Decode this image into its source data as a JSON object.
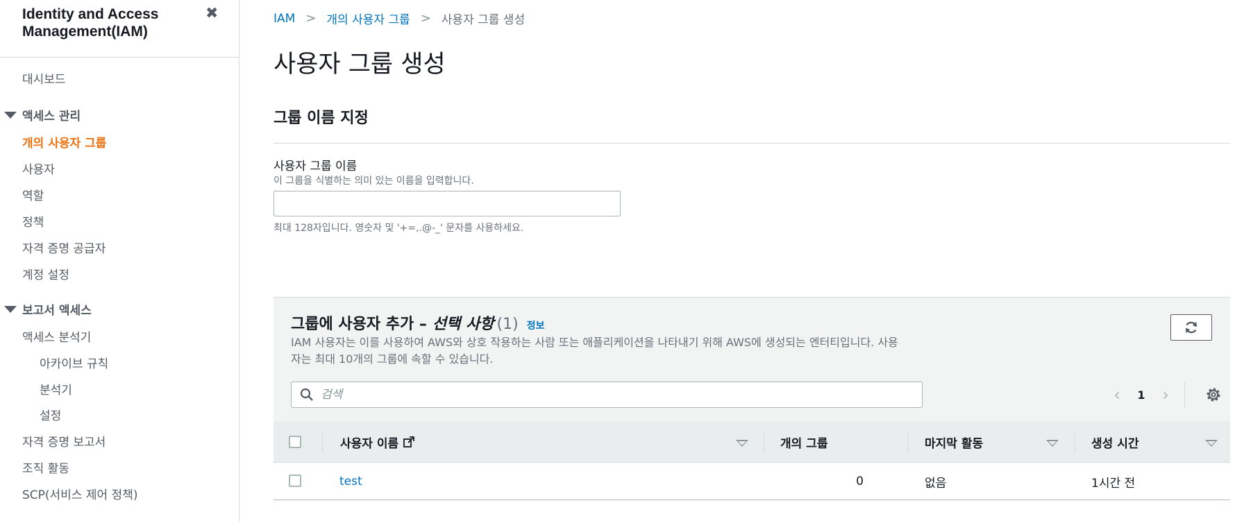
{
  "sidebar": {
    "title": "Identity and Access Management(IAM)",
    "close_icon": "close-icon",
    "items": {
      "dashboard": "대시보드",
      "access_mgmt": "액세스 관리",
      "user_groups": "개의 사용자 그룹",
      "users": "사용자",
      "roles": "역할",
      "policies": "정책",
      "identity_providers": "자격 증명 공급자",
      "account_settings": "계정 설정",
      "report_access": "보고서 액세스",
      "access_analyzer": "액세스 분석기",
      "archive_rules": "아카이브 규칙",
      "analyzers": "분석기",
      "settings": "설정",
      "credential_report": "자격 증명 보고서",
      "org_activity": "조직 활동",
      "scp": "SCP(서비스 제어 정책)"
    },
    "active_color": "#ec7211"
  },
  "breadcrumb": {
    "root": "IAM",
    "parent": "개의 사용자 그룹",
    "current": "사용자 그룹 생성"
  },
  "page": {
    "title": "사용자 그룹 생성",
    "section_title": "그룹 이름 지정",
    "field_label": "사용자 그룹 이름",
    "field_description": "이 그룹을 식별하는 의미 있는 이름을 입력합니다.",
    "field_value": "",
    "field_hint": "최대 128자입니다. 영숫자 및 '+=,.@-_' 문자를 사용하세요."
  },
  "users_panel": {
    "title": "그룹에 사용자 추가 –",
    "title_optional": "선택 사항",
    "count": "(1)",
    "info_link": "정보",
    "description": "IAM 사용자는 이를 사용하여 AWS와 상호 작용하는 사람 또는 애플리케이션을 나타내기 위해 AWS에 생성되는 엔터티입니다. 사용자는 최대 10개의 그룹에 속할 수 있습니다.",
    "search_placeholder": "검색",
    "page_number": "1",
    "columns": {
      "username": "사용자 이름",
      "groups": "개의 그룹",
      "last_activity": "마지막 활동",
      "created": "생성 시간"
    },
    "rows": [
      {
        "username": "test",
        "groups": "0",
        "last_activity": "없음",
        "created": "1시간 전"
      }
    ]
  },
  "colors": {
    "link": "#0073bb",
    "accent": "#ec7211"
  }
}
